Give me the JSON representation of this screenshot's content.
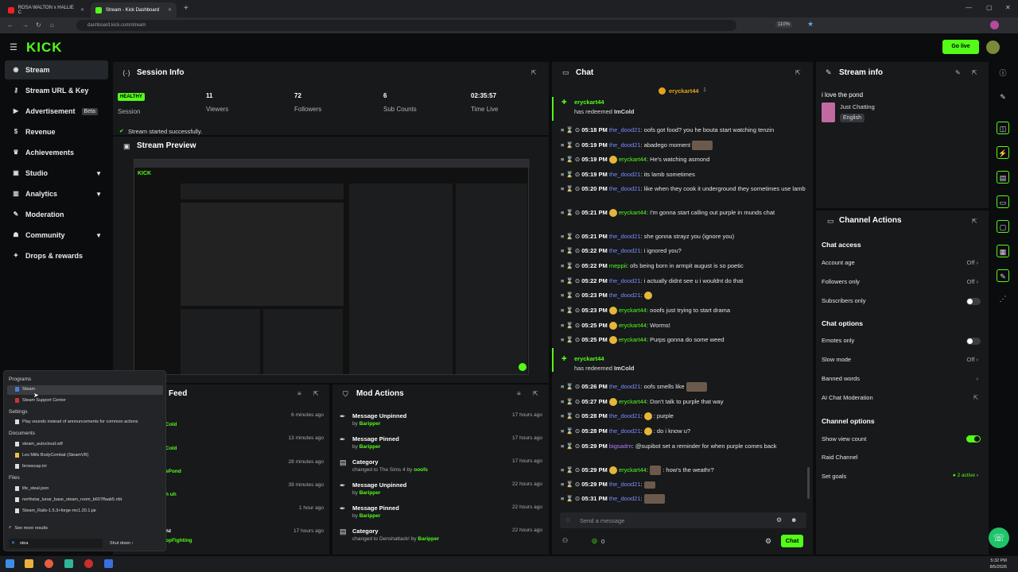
{
  "browser": {
    "tabs": [
      {
        "label": "ROSA WALTON x HALLIE C"
      },
      {
        "label": "Stream - Kick Dashboard"
      }
    ],
    "url": "dashboard.kick.com/stream",
    "zoom": "110%"
  },
  "header": {
    "logo": "KICK",
    "golive": "Go live"
  },
  "sidebar": {
    "items": [
      {
        "label": "Stream",
        "icon": "broadcast-icon"
      },
      {
        "label": "Stream URL & Key",
        "icon": "key-icon"
      },
      {
        "label": "Advertisement",
        "badge": "Beta",
        "icon": "megaphone-icon"
      },
      {
        "label": "Revenue",
        "icon": "dollar-icon"
      },
      {
        "label": "Achievements",
        "icon": "trophy-icon"
      },
      {
        "label": "Studio",
        "icon": "studio-icon"
      },
      {
        "label": "Analytics",
        "icon": "analytics-icon"
      },
      {
        "label": "Moderation",
        "icon": "wrench-icon"
      },
      {
        "label": "Community",
        "icon": "community-icon"
      },
      {
        "label": "Drops & rewards",
        "icon": "gift-icon"
      }
    ]
  },
  "session": {
    "title": "Session Info",
    "status": "HEALTHY",
    "status_label": "Session",
    "stats": [
      {
        "value": "11",
        "label": "Viewers"
      },
      {
        "value": "72",
        "label": "Followers"
      },
      {
        "value": "6",
        "label": "Sub Counts"
      },
      {
        "value": "02:35:57",
        "label": "Time Live"
      }
    ],
    "message": "Stream started successfully."
  },
  "preview": {
    "title": "Stream Preview"
  },
  "feed": {
    "title": "Feed",
    "rows": [
      {
        "name": "Cold",
        "time": "6 minutes ago"
      },
      {
        "name": "Cold",
        "time": "13 minutes ago"
      },
      {
        "name": "ePond",
        "time": "28 minutes ago"
      },
      {
        "name": "h uh",
        "time": "39 minutes ago"
      },
      {
        "name": "",
        "time": "1 hour ago"
      },
      {
        "name": "nz",
        "time": "17 hours ago"
      },
      {
        "name": "opFighting",
        "time": ""
      }
    ]
  },
  "mod_actions": {
    "title": "Mod Actions",
    "rows": [
      {
        "title": "Message Unpinned",
        "by": "by",
        "user": "Baripper",
        "time": "17 hours ago",
        "icon": "pin-icon"
      },
      {
        "title": "Message Pinned",
        "by": "by",
        "user": "Baripper",
        "time": "17 hours ago",
        "icon": "pin-icon"
      },
      {
        "title": "Category",
        "by": "changed to The Sims 4 by",
        "user": "ooofs",
        "time": "17 hours ago",
        "icon": "category-icon"
      },
      {
        "title": "Message Unpinned",
        "by": "by",
        "user": "Baripper",
        "time": "22 hours ago",
        "icon": "pin-icon"
      },
      {
        "title": "Message Pinned",
        "by": "by",
        "user": "Baripper",
        "time": "22 hours ago",
        "icon": "pin-icon"
      },
      {
        "title": "Category",
        "by": "changed to Denshattack! by",
        "user": "Baripper",
        "time": "22 hours ago",
        "icon": "category-icon"
      }
    ]
  },
  "chat": {
    "title": "Chat",
    "pinned_user": "eryckart44",
    "pinned_count": "1",
    "redeem1_user": "eryckart44",
    "redeem1_text": "has redeemed",
    "redeem1_reward": "ImCold",
    "messages": [
      {
        "time": "05:18 PM",
        "user": "the_dood21",
        "text": ": oofs got food? you he bouta start watching tenzin"
      },
      {
        "time": "05:19 PM",
        "user": "the_dood21",
        "text": ": abadego moment"
      },
      {
        "time": "05:19 PM",
        "user": "eryckart44",
        "text": ": He's watching asmond"
      },
      {
        "time": "05:19 PM",
        "user": "the_dood21",
        "text": ": its lamb sometimes"
      },
      {
        "time": "05:20 PM",
        "user": "the_dood21",
        "text": ": like when they cook it underground they sometimes use lamb"
      },
      {
        "time": "05:21 PM",
        "user": "eryckart44",
        "text": ": I'm gonna start calling out purple in munds chat"
      },
      {
        "time": "05:21 PM",
        "user": "the_dood21",
        "text": ": she gonna strayz you (ignore you)"
      },
      {
        "time": "05:22 PM",
        "user": "the_dood21",
        "text": ": i ignored you?"
      },
      {
        "time": "05:22 PM",
        "user": "meppii",
        "text": ": ofs being born in armpit august is so poetic"
      },
      {
        "time": "05:22 PM",
        "user": "the_dood21",
        "text": ": i actually didnt see u i wouldnt do that"
      },
      {
        "time": "05:23 PM",
        "user": "the_dood21",
        "text": ":"
      },
      {
        "time": "05:23 PM",
        "user": "eryckart44",
        "text": ": ooofs just trying to start drama"
      },
      {
        "time": "05:25 PM",
        "user": "eryckart44",
        "text": ": Worms!"
      },
      {
        "time": "05:25 PM",
        "user": "eryckart44",
        "text": ": Purps gonna do some weed"
      }
    ],
    "redeem2_user": "eryckart44",
    "redeem2_text": "has redeemed",
    "redeem2_reward": "ImCold",
    "messages2": [
      {
        "time": "05:26 PM",
        "user": "the_dood21",
        "text": ": oofs smells like"
      },
      {
        "time": "05:27 PM",
        "user": "eryckart44",
        "text": ": Don't talk to purple that way"
      },
      {
        "time": "05:28 PM",
        "user": "the_dood21",
        "text": ": purple"
      },
      {
        "time": "05:28 PM",
        "user": "the_dood21",
        "text": ": do i know u?"
      },
      {
        "time": "05:29 PM",
        "user": "bigsadrn",
        "text": ": @supibot set a reminder for when purple comes back"
      },
      {
        "time": "05:29 PM",
        "user": "eryckart44",
        "text": ": how's the weathr?"
      },
      {
        "time": "05:29 PM",
        "user": "the_dood21",
        "text": ":"
      },
      {
        "time": "05:31 PM",
        "user": "the_dood21",
        "text": ":"
      }
    ],
    "input_placeholder": "Send a message",
    "viewer_count": "0",
    "send": "Chat"
  },
  "stream_info": {
    "title": "Stream info",
    "stream_title": "i love the pond",
    "category": "Just Chatting",
    "language": "English"
  },
  "channel_actions": {
    "title": "Channel Actions",
    "chat_access": "Chat access",
    "account_age": "Account age",
    "account_age_val": "Off",
    "followers_only": "Followers only",
    "followers_only_val": "Off",
    "subscribers_only": "Subscribers only",
    "chat_options": "Chat options",
    "emotes_only": "Emotes only",
    "slow_mode": "Slow mode",
    "slow_mode_val": "Off",
    "banned_words": "Banned words",
    "ai_moderation": "AI Chat Moderation",
    "channel_options": "Channel options",
    "show_view_count": "Show view count",
    "raid_channel": "Raid Channel",
    "set_goals": "Set goals",
    "set_goals_val": "2 active"
  },
  "start_menu": {
    "programs_h": "Programs",
    "programs": [
      "Steam",
      "Steam Support Center"
    ],
    "settings_h": "Settings",
    "settings": [
      "Play sounds instead of announcements for common actions"
    ],
    "documents_h": "Documents",
    "documents": [
      "steam_autocloud.vdf",
      "Les Mills BodyCombat (SteamVR)",
      "browscap.ini"
    ],
    "files_h": "Files",
    "files": [
      "life_steal.json",
      "northstar_lunar_base_steam_room_b607ffaab5.nbt",
      "Steam_Rails-1.5.3+forge-mc1.20.1.jar"
    ],
    "see_more": "See more results",
    "search": "stea",
    "shutdown": "Shut down"
  },
  "taskbar": {
    "time": "5:32 PM",
    "date": "8/5/2026"
  }
}
